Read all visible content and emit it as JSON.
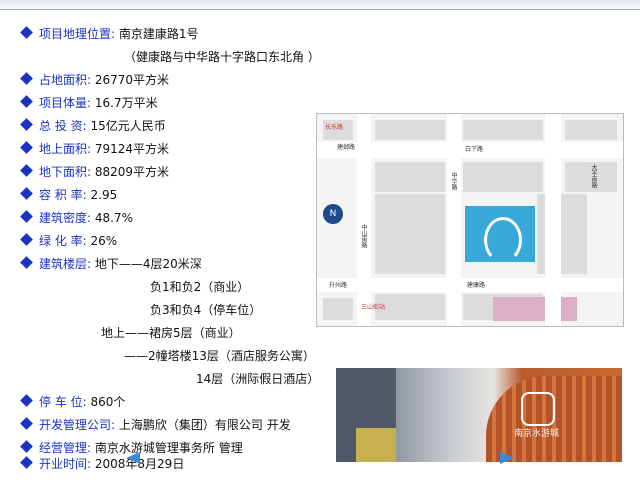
{
  "items": [
    {
      "label": "项目地理位置:",
      "value": "南京建康路1号"
    },
    {
      "label": "占地面积:",
      "value": "26770平方米"
    },
    {
      "label": "项目体量:",
      "value": "16.7万平米"
    },
    {
      "label": "总 投 资:",
      "value": "15亿元人民币"
    },
    {
      "label": "地上面积:",
      "value": "79124平方米"
    },
    {
      "label": "地下面积:",
      "value": "88209平方米"
    },
    {
      "label": "容 积 率:",
      "value": "2.95"
    },
    {
      "label": "建筑密度:",
      "value": "48.7%"
    },
    {
      "label": "绿 化 率:",
      "value": "26%"
    },
    {
      "label": "建筑楼层:",
      "value": "地下——4层20米深"
    },
    {
      "label": "停 车 位:",
      "value": "860个"
    },
    {
      "label": "开发管理公司:",
      "value": "上海鹏欣（集团）有限公司 开发"
    },
    {
      "label": "经营管理:",
      "value": "南京水游城管理事务所 管理"
    },
    {
      "label": "开业时间:",
      "value": "2008年8月29日"
    }
  ],
  "address_note": "（健康路与中华路十字路口东北角 ）",
  "floors": {
    "b1b2": "负1和负2（商业）",
    "b3b4": "负3和负4（停车位）",
    "above": "地上——裙房5层（商业）",
    "towers": "——2幢塔楼13层（酒店服务公寓）",
    "hotel": "14层（洲际假日酒店）"
  },
  "map": {
    "labels": [
      "长乐路",
      "建邺路",
      "白下路",
      "中华路",
      "中山南路",
      "升州路",
      "建康路",
      "大平南路",
      "三山街站"
    ],
    "north": "N"
  },
  "photo_sign": "南京水游城"
}
